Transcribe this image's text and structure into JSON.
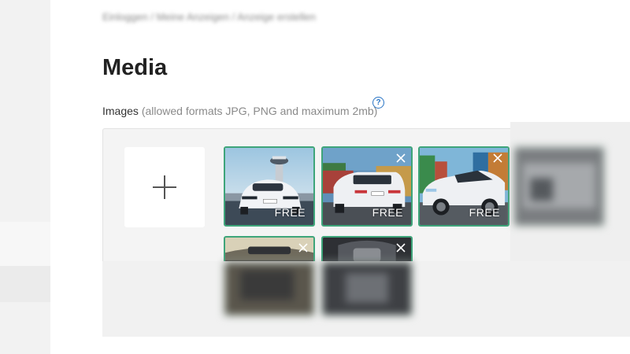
{
  "breadcrumb": "Einloggen / Meine Anzeigen / Anzeige erstellen",
  "page": {
    "title": "Media"
  },
  "images": {
    "label": "Images",
    "hint": "(allowed formats JPG, PNG and maximum 2mb)",
    "help_icon": "?",
    "add_icon": "plus-icon",
    "tiles": [
      {
        "badge": "FREE",
        "description": "white BMW sedan front view near airport tower"
      },
      {
        "badge": "FREE",
        "description": "white BMW wagon rear view at container port"
      },
      {
        "badge": "FREE",
        "description": "white BMW sedan side view at container port"
      },
      {
        "badge": "",
        "description": "blurred image"
      },
      {
        "badge": "",
        "description": "car interior dashboard"
      },
      {
        "badge": "",
        "description": "car interior seats"
      }
    ]
  },
  "colors": {
    "accent_border": "#3ea57a",
    "help_blue": "#2a75c5",
    "title": "#222222"
  }
}
